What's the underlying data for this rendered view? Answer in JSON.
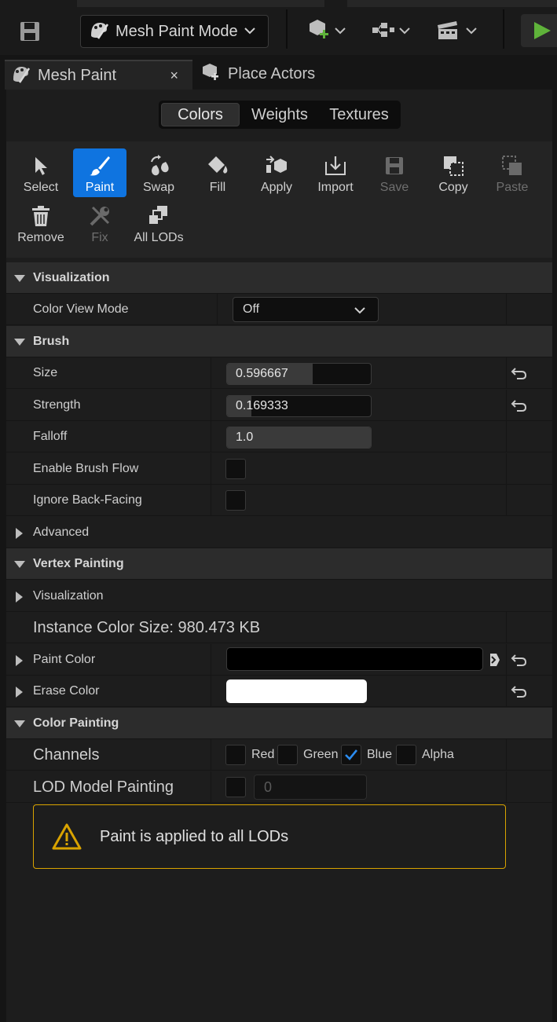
{
  "toolbar": {
    "mode_label": "Mesh Paint Mode",
    "icons": [
      "save-icon",
      "mesh-paint-mode-icon",
      "add-actor-icon",
      "blueprint-icon",
      "cinematics-icon",
      "play-icon"
    ]
  },
  "tabs": [
    {
      "label": "Mesh Paint",
      "close": "×"
    },
    {
      "label": "Place Actors"
    }
  ],
  "segments": [
    "Colors",
    "Weights",
    "Textures"
  ],
  "tools": [
    {
      "label": "Select",
      "icon": "cursor-icon"
    },
    {
      "label": "Paint",
      "icon": "brush-icon",
      "active": true
    },
    {
      "label": "Swap",
      "icon": "swap-icon"
    },
    {
      "label": "Fill",
      "icon": "fill-bucket-icon"
    },
    {
      "label": "Apply",
      "icon": "apply-icon"
    },
    {
      "label": "Import",
      "icon": "import-icon"
    },
    {
      "label": "Save",
      "icon": "save-icon",
      "disabled": true
    },
    {
      "label": "Copy",
      "icon": "copy-icon"
    },
    {
      "label": "Paste",
      "icon": "paste-icon",
      "disabled": true
    },
    {
      "label": "Remove",
      "icon": "trash-icon"
    },
    {
      "label": "Fix",
      "icon": "wrench-icon",
      "disabled": true
    },
    {
      "label": "All LODs",
      "icon": "all-lods-icon"
    }
  ],
  "visualization": {
    "header": "Visualization",
    "color_view_mode_label": "Color View Mode",
    "color_view_mode_value": "Off"
  },
  "brush": {
    "header": "Brush",
    "size_label": "Size",
    "size_value": "0.596667",
    "size_fraction": 0.5967,
    "strength_label": "Strength",
    "strength_value": "0.169333",
    "strength_fraction": 0.1693,
    "falloff_label": "Falloff",
    "falloff_value": "1.0",
    "falloff_fraction": 1.0,
    "flow_label": "Enable Brush Flow",
    "backface_label": "Ignore Back-Facing",
    "advanced_label": "Advanced"
  },
  "vertex": {
    "header": "Vertex Painting",
    "visualization_label": "Visualization",
    "instance_size": "Instance Color Size: 980.473 KB",
    "paint_color_label": "Paint Color",
    "paint_color": "#000000",
    "erase_color_label": "Erase Color",
    "erase_color": "#ffffff"
  },
  "color_painting": {
    "header": "Color Painting",
    "channels_label": "Channels",
    "channels": [
      {
        "label": "Red",
        "checked": false
      },
      {
        "label": "Green",
        "checked": false
      },
      {
        "label": "Blue",
        "checked": true
      },
      {
        "label": "Alpha",
        "checked": false
      }
    ],
    "lod_label": "LOD Model Painting",
    "lod_value": "0",
    "warning": "Paint is applied to all LODs"
  },
  "colors": {
    "accent": "#0f74e0",
    "warning": "#d9a300",
    "play": "#5fb33a"
  }
}
